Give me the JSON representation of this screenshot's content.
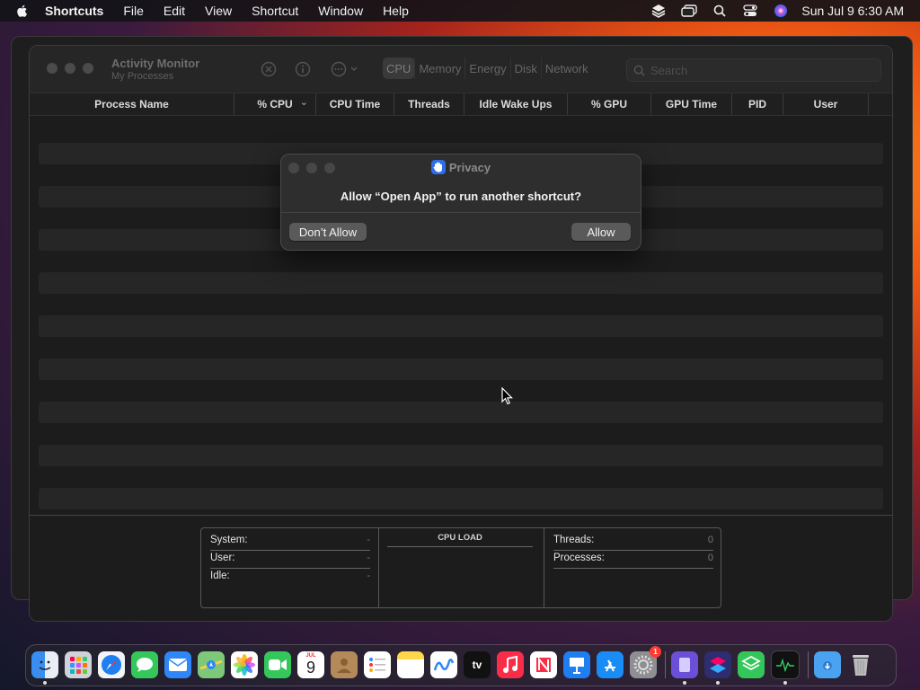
{
  "menubar": {
    "app_name": "Shortcuts",
    "items": [
      "File",
      "Edit",
      "View",
      "Shortcut",
      "Window",
      "Help"
    ],
    "clock": "Sun Jul 9  6:30 AM",
    "status_icons": [
      "layers-icon",
      "screen-mirror-icon",
      "spotlight-search-icon",
      "control-center-icon",
      "siri-icon"
    ]
  },
  "window": {
    "title": "Activity Monitor",
    "subtitle": "My Processes",
    "tabs": [
      "CPU",
      "Memory",
      "Energy",
      "Disk",
      "Network"
    ],
    "search_placeholder": "Search",
    "columns": [
      "Process Name",
      "% CPU",
      "CPU Time",
      "Threads",
      "Idle Wake Ups",
      "% GPU",
      "GPU Time",
      "PID",
      "User"
    ],
    "sort_indicator": "⌄"
  },
  "stats": {
    "left": [
      {
        "label": "System:",
        "value": "-"
      },
      {
        "label": "User:",
        "value": "-"
      },
      {
        "label": "Idle:",
        "value": "-"
      }
    ],
    "cpu_load_title": "CPU LOAD",
    "right": [
      {
        "label": "Threads:",
        "value": "0"
      },
      {
        "label": "Processes:",
        "value": "0"
      }
    ]
  },
  "dialog": {
    "title": "Privacy",
    "message": "Allow “Open App” to run another shortcut?",
    "deny_label": "Don’t Allow",
    "allow_label": "Allow"
  },
  "dock": {
    "calendar_month": "JUL",
    "calendar_day": "9",
    "tv_label": "tv",
    "settings_badge": "1",
    "icons": [
      "finder-icon",
      "launchpad-icon",
      "safari-icon",
      "messages-icon",
      "mail-icon",
      "maps-icon",
      "photos-icon",
      "facetime-icon",
      "calendar-icon",
      "contacts-icon",
      "reminders-icon",
      "notes-icon",
      "freeform-icon",
      "apple-tv-icon",
      "music-icon",
      "news-icon",
      "keynote-icon",
      "app-store-icon",
      "system-settings-icon",
      "simulator-icon",
      "shortcuts-icon",
      "layers-app-icon",
      "activity-monitor-icon",
      "downloads-folder-icon",
      "trash-icon"
    ]
  },
  "colors": {
    "dialog_allow": "#5a5a5a",
    "hand_icon": "#2d6fe8",
    "badge": "#ff3b30"
  }
}
